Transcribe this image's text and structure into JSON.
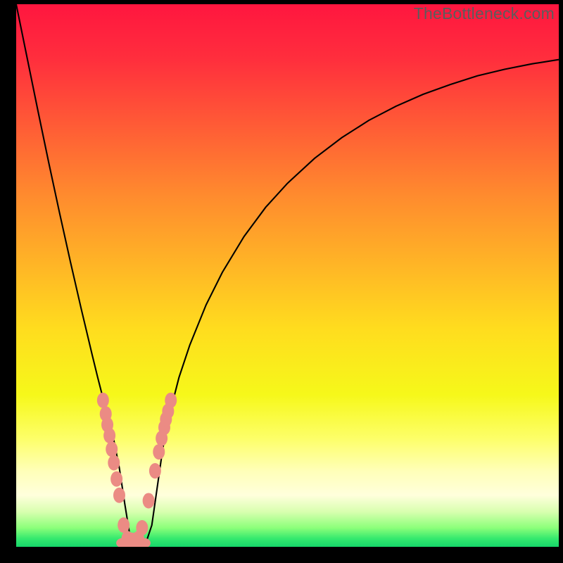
{
  "watermark": "TheBottleneck.com",
  "gradient": {
    "stops": [
      {
        "offset": 0.0,
        "color": "#ff163f"
      },
      {
        "offset": 0.1,
        "color": "#ff2e3d"
      },
      {
        "offset": 0.22,
        "color": "#ff5a36"
      },
      {
        "offset": 0.35,
        "color": "#ff8a2e"
      },
      {
        "offset": 0.48,
        "color": "#ffb526"
      },
      {
        "offset": 0.6,
        "color": "#ffdd1e"
      },
      {
        "offset": 0.72,
        "color": "#f6f81a"
      },
      {
        "offset": 0.8,
        "color": "#fdff68"
      },
      {
        "offset": 0.86,
        "color": "#ffffb8"
      },
      {
        "offset": 0.905,
        "color": "#ffffdc"
      },
      {
        "offset": 0.935,
        "color": "#d9ffb0"
      },
      {
        "offset": 0.965,
        "color": "#8cff7a"
      },
      {
        "offset": 0.985,
        "color": "#34e96e"
      },
      {
        "offset": 1.0,
        "color": "#16d66a"
      }
    ]
  },
  "chart_data": {
    "type": "line",
    "title": "",
    "xlabel": "",
    "ylabel": "",
    "x_range": [
      0,
      100
    ],
    "y_range": [
      0,
      100
    ],
    "x": [
      0,
      2,
      4,
      6,
      8,
      10,
      12,
      14,
      15,
      16,
      17,
      18,
      19,
      20,
      21,
      22,
      23,
      24,
      25,
      26,
      27,
      28,
      30,
      32,
      35,
      38,
      42,
      46,
      50,
      55,
      60,
      65,
      70,
      75,
      80,
      85,
      90,
      95,
      100
    ],
    "y": [
      100,
      90.2,
      80.4,
      70.8,
      61.5,
      52.5,
      43.8,
      35.4,
      31.3,
      27.4,
      23.6,
      19.6,
      14.6,
      8.0,
      1.8,
      0.3,
      0.3,
      1.0,
      4.0,
      11.0,
      18.0,
      23.4,
      31.2,
      37.2,
      44.6,
      50.6,
      57.2,
      62.6,
      67.0,
      71.6,
      75.4,
      78.6,
      81.2,
      83.4,
      85.2,
      86.8,
      88.0,
      89.0,
      89.8
    ],
    "markers": {
      "x": [
        16.0,
        16.5,
        16.8,
        17.2,
        17.6,
        18.0,
        18.5,
        19.0,
        19.8,
        20.5,
        21.3,
        22.0,
        22.5,
        23.2,
        24.4,
        25.6,
        26.3,
        26.8,
        27.3,
        27.6,
        28.0,
        28.5
      ],
      "y": [
        27.0,
        24.5,
        22.5,
        20.5,
        18.0,
        15.5,
        12.5,
        9.5,
        4.0,
        1.5,
        1.2,
        1.2,
        1.5,
        3.5,
        8.5,
        14.0,
        17.5,
        20.0,
        22.0,
        23.5,
        25.0,
        27.0
      ]
    },
    "flat_markers": {
      "x": [
        19.6,
        20.4,
        21.2,
        22.0,
        22.8,
        23.6
      ],
      "y": [
        0.7,
        0.7,
        0.7,
        0.7,
        0.7,
        0.7
      ]
    },
    "marker_color": "#eb8b84",
    "curve_color": "#000000"
  }
}
